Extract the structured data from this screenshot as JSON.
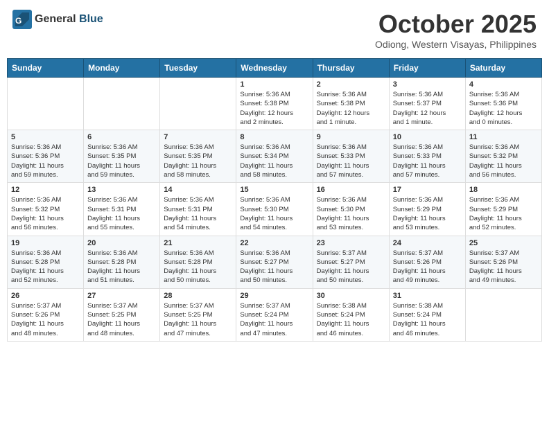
{
  "header": {
    "logo_general": "General",
    "logo_blue": "Blue",
    "month_title": "October 2025",
    "location": "Odiong, Western Visayas, Philippines"
  },
  "weekdays": [
    "Sunday",
    "Monday",
    "Tuesday",
    "Wednesday",
    "Thursday",
    "Friday",
    "Saturday"
  ],
  "weeks": [
    [
      {
        "day": "",
        "info": ""
      },
      {
        "day": "",
        "info": ""
      },
      {
        "day": "",
        "info": ""
      },
      {
        "day": "1",
        "info": "Sunrise: 5:36 AM\nSunset: 5:38 PM\nDaylight: 12 hours\nand 2 minutes."
      },
      {
        "day": "2",
        "info": "Sunrise: 5:36 AM\nSunset: 5:38 PM\nDaylight: 12 hours\nand 1 minute."
      },
      {
        "day": "3",
        "info": "Sunrise: 5:36 AM\nSunset: 5:37 PM\nDaylight: 12 hours\nand 1 minute."
      },
      {
        "day": "4",
        "info": "Sunrise: 5:36 AM\nSunset: 5:36 PM\nDaylight: 12 hours\nand 0 minutes."
      }
    ],
    [
      {
        "day": "5",
        "info": "Sunrise: 5:36 AM\nSunset: 5:36 PM\nDaylight: 11 hours\nand 59 minutes."
      },
      {
        "day": "6",
        "info": "Sunrise: 5:36 AM\nSunset: 5:35 PM\nDaylight: 11 hours\nand 59 minutes."
      },
      {
        "day": "7",
        "info": "Sunrise: 5:36 AM\nSunset: 5:35 PM\nDaylight: 11 hours\nand 58 minutes."
      },
      {
        "day": "8",
        "info": "Sunrise: 5:36 AM\nSunset: 5:34 PM\nDaylight: 11 hours\nand 58 minutes."
      },
      {
        "day": "9",
        "info": "Sunrise: 5:36 AM\nSunset: 5:33 PM\nDaylight: 11 hours\nand 57 minutes."
      },
      {
        "day": "10",
        "info": "Sunrise: 5:36 AM\nSunset: 5:33 PM\nDaylight: 11 hours\nand 57 minutes."
      },
      {
        "day": "11",
        "info": "Sunrise: 5:36 AM\nSunset: 5:32 PM\nDaylight: 11 hours\nand 56 minutes."
      }
    ],
    [
      {
        "day": "12",
        "info": "Sunrise: 5:36 AM\nSunset: 5:32 PM\nDaylight: 11 hours\nand 56 minutes."
      },
      {
        "day": "13",
        "info": "Sunrise: 5:36 AM\nSunset: 5:31 PM\nDaylight: 11 hours\nand 55 minutes."
      },
      {
        "day": "14",
        "info": "Sunrise: 5:36 AM\nSunset: 5:31 PM\nDaylight: 11 hours\nand 54 minutes."
      },
      {
        "day": "15",
        "info": "Sunrise: 5:36 AM\nSunset: 5:30 PM\nDaylight: 11 hours\nand 54 minutes."
      },
      {
        "day": "16",
        "info": "Sunrise: 5:36 AM\nSunset: 5:30 PM\nDaylight: 11 hours\nand 53 minutes."
      },
      {
        "day": "17",
        "info": "Sunrise: 5:36 AM\nSunset: 5:29 PM\nDaylight: 11 hours\nand 53 minutes."
      },
      {
        "day": "18",
        "info": "Sunrise: 5:36 AM\nSunset: 5:29 PM\nDaylight: 11 hours\nand 52 minutes."
      }
    ],
    [
      {
        "day": "19",
        "info": "Sunrise: 5:36 AM\nSunset: 5:28 PM\nDaylight: 11 hours\nand 52 minutes."
      },
      {
        "day": "20",
        "info": "Sunrise: 5:36 AM\nSunset: 5:28 PM\nDaylight: 11 hours\nand 51 minutes."
      },
      {
        "day": "21",
        "info": "Sunrise: 5:36 AM\nSunset: 5:28 PM\nDaylight: 11 hours\nand 50 minutes."
      },
      {
        "day": "22",
        "info": "Sunrise: 5:36 AM\nSunset: 5:27 PM\nDaylight: 11 hours\nand 50 minutes."
      },
      {
        "day": "23",
        "info": "Sunrise: 5:37 AM\nSunset: 5:27 PM\nDaylight: 11 hours\nand 50 minutes."
      },
      {
        "day": "24",
        "info": "Sunrise: 5:37 AM\nSunset: 5:26 PM\nDaylight: 11 hours\nand 49 minutes."
      },
      {
        "day": "25",
        "info": "Sunrise: 5:37 AM\nSunset: 5:26 PM\nDaylight: 11 hours\nand 49 minutes."
      }
    ],
    [
      {
        "day": "26",
        "info": "Sunrise: 5:37 AM\nSunset: 5:26 PM\nDaylight: 11 hours\nand 48 minutes."
      },
      {
        "day": "27",
        "info": "Sunrise: 5:37 AM\nSunset: 5:25 PM\nDaylight: 11 hours\nand 48 minutes."
      },
      {
        "day": "28",
        "info": "Sunrise: 5:37 AM\nSunset: 5:25 PM\nDaylight: 11 hours\nand 47 minutes."
      },
      {
        "day": "29",
        "info": "Sunrise: 5:37 AM\nSunset: 5:24 PM\nDaylight: 11 hours\nand 47 minutes."
      },
      {
        "day": "30",
        "info": "Sunrise: 5:38 AM\nSunset: 5:24 PM\nDaylight: 11 hours\nand 46 minutes."
      },
      {
        "day": "31",
        "info": "Sunrise: 5:38 AM\nSunset: 5:24 PM\nDaylight: 11 hours\nand 46 minutes."
      },
      {
        "day": "",
        "info": ""
      }
    ]
  ]
}
